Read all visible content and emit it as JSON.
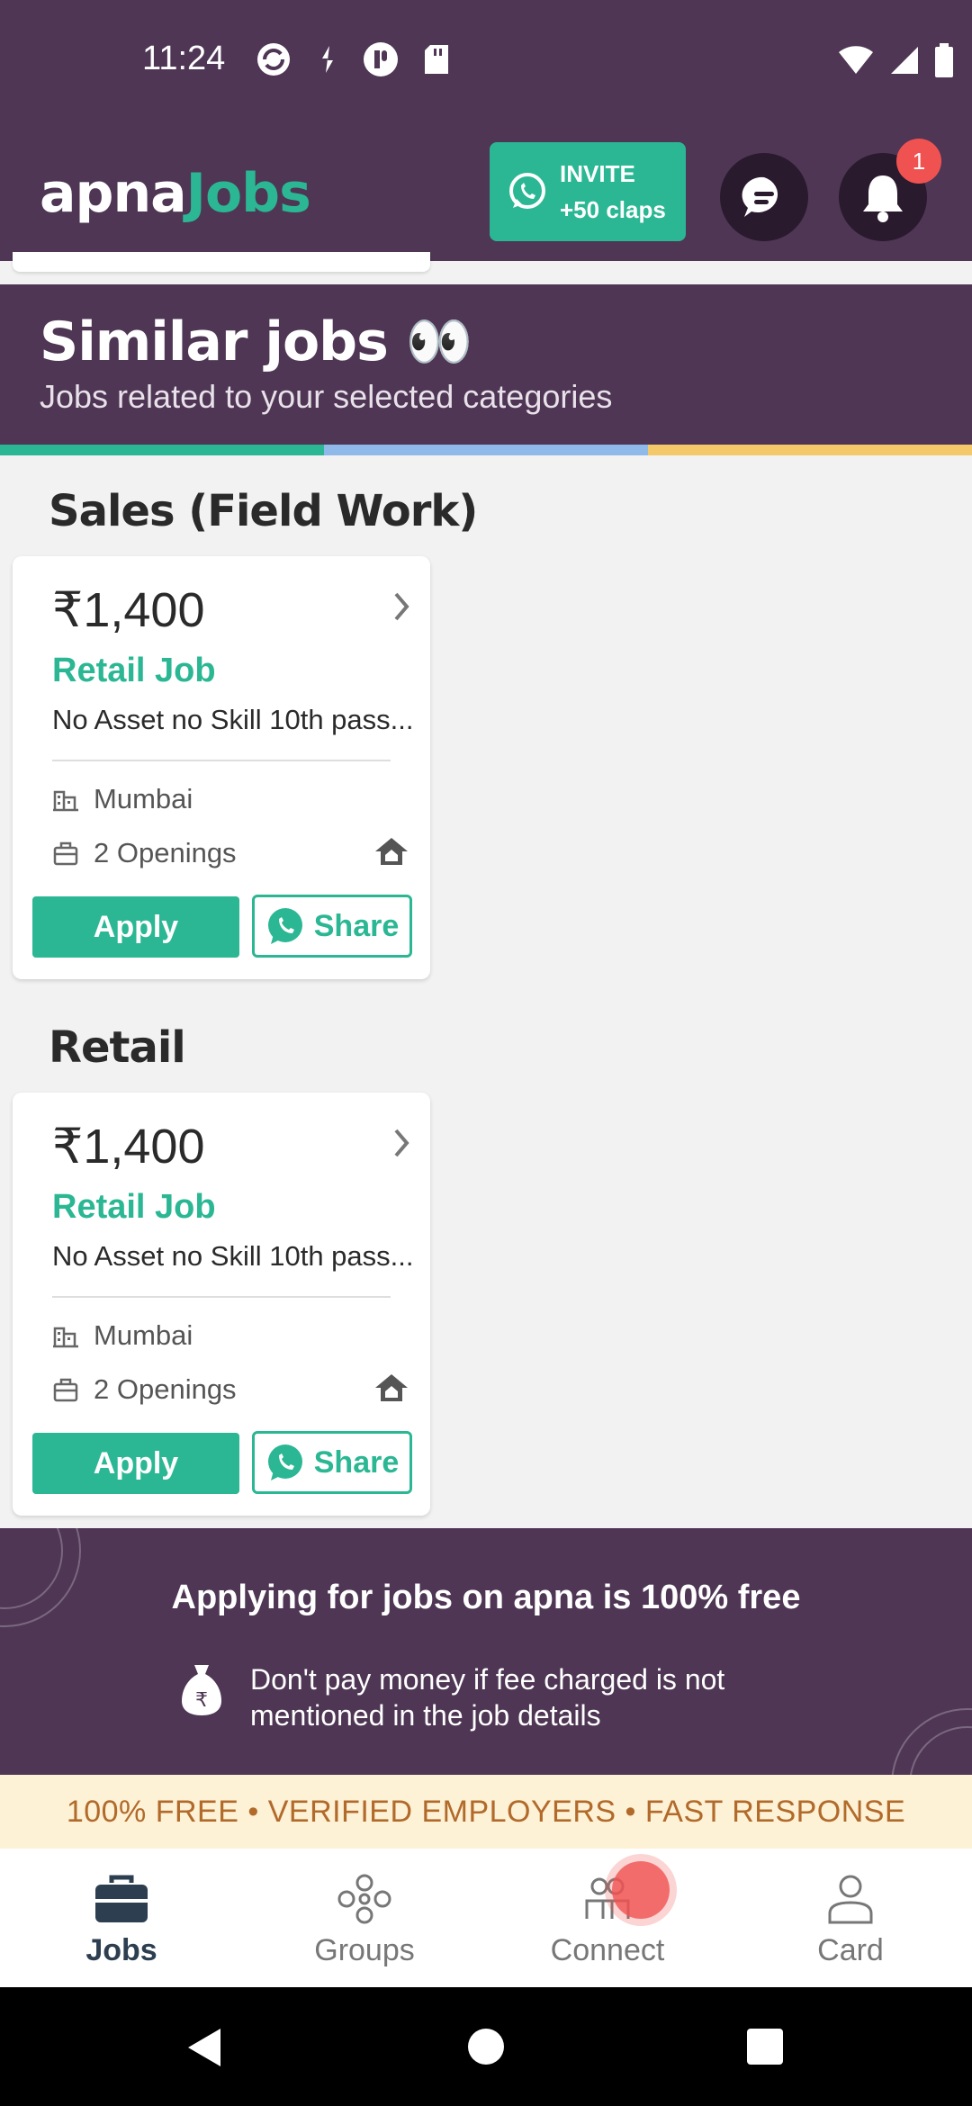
{
  "status_bar": {
    "time": "11:24"
  },
  "header": {
    "logo_part1": "apna",
    "logo_part2": "Jobs",
    "invite_label": "INVITE",
    "invite_sub": "+50 claps",
    "notification_count": "1",
    "brand_color": "#2bb793",
    "header_color": "#4e3654"
  },
  "banner": {
    "title": "Similar jobs 👀",
    "subtitle": "Jobs related to your selected categories"
  },
  "sections": [
    {
      "title": "Sales (Field Work)",
      "job": {
        "salary": "₹1,400",
        "title": "Retail Job",
        "description": "No Asset no Skill 10th pass...",
        "location": "Mumbai",
        "openings": "2 Openings",
        "apply_label": "Apply",
        "share_label": "Share"
      }
    },
    {
      "title": "Retail",
      "job": {
        "salary": "₹1,400",
        "title": "Retail Job",
        "description": "No Asset no Skill 10th pass...",
        "location": "Mumbai",
        "openings": "2 Openings",
        "apply_label": "Apply",
        "share_label": "Share"
      }
    }
  ],
  "info_panel": {
    "title": "Applying for jobs on apna is 100% free",
    "text": "Don't pay money if fee charged is not mentioned in the job details"
  },
  "free_strip": "100% FREE  • VERIFIED EMPLOYERS •  FAST RESPONSE",
  "bottom_nav": [
    {
      "label": "Jobs",
      "icon": "briefcase-icon",
      "active": true
    },
    {
      "label": "Groups",
      "icon": "groups-icon",
      "active": false
    },
    {
      "label": "Connect",
      "icon": "connect-icon",
      "active": false
    },
    {
      "label": "Card",
      "icon": "person-icon",
      "active": false
    }
  ]
}
